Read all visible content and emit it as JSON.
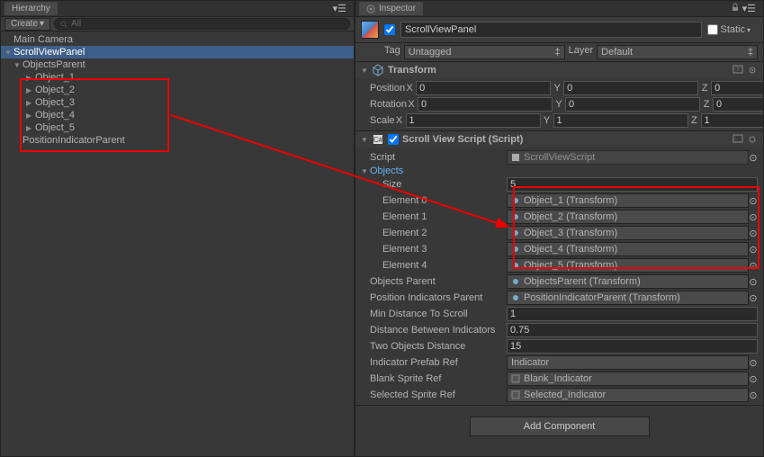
{
  "hierarchy": {
    "tab_label": "Hierarchy",
    "create_label": "Create",
    "search_placeholder": "All",
    "items": [
      {
        "label": "Main Camera",
        "indent": 0,
        "expand": ""
      },
      {
        "label": "ScrollViewPanel",
        "indent": 0,
        "expand": "down",
        "selected": true
      },
      {
        "label": "ObjectsParent",
        "indent": 1,
        "expand": "down"
      },
      {
        "label": "Object_1",
        "indent": 2,
        "expand": "right"
      },
      {
        "label": "Object_2",
        "indent": 2,
        "expand": "right"
      },
      {
        "label": "Object_3",
        "indent": 2,
        "expand": "right"
      },
      {
        "label": "Object_4",
        "indent": 2,
        "expand": "right"
      },
      {
        "label": "Object_5",
        "indent": 2,
        "expand": "right"
      },
      {
        "label": "PositionIndicatorParent",
        "indent": 1,
        "expand": ""
      }
    ]
  },
  "inspector": {
    "tab_label": "Inspector",
    "name": "ScrollViewPanel",
    "static_label": "Static",
    "tag_label": "Tag",
    "tag_value": "Untagged",
    "layer_label": "Layer",
    "layer_value": "Default",
    "transform": {
      "title": "Transform",
      "position_label": "Position",
      "rotation_label": "Rotation",
      "scale_label": "Scale",
      "position": {
        "x": "0",
        "y": "0",
        "z": "0"
      },
      "rotation": {
        "x": "0",
        "y": "0",
        "z": "0"
      },
      "scale": {
        "x": "1",
        "y": "1",
        "z": "1"
      }
    },
    "script": {
      "title": "Scroll View Script (Script)",
      "script_label": "Script",
      "script_value": "ScrollViewScript",
      "objects_label": "Objects",
      "size_label": "Size",
      "size_value": "5",
      "elements": [
        {
          "label": "Element 0",
          "value": "Object_1 (Transform)"
        },
        {
          "label": "Element 1",
          "value": "Object_2 (Transform)"
        },
        {
          "label": "Element 2",
          "value": "Object_3 (Transform)"
        },
        {
          "label": "Element 3",
          "value": "Object_4 (Transform)"
        },
        {
          "label": "Element 4",
          "value": "Object_5 (Transform)"
        }
      ],
      "objects_parent_label": "Objects Parent",
      "objects_parent_value": "ObjectsParent (Transform)",
      "pos_ind_parent_label": "Position Indicators Parent",
      "pos_ind_parent_value": "PositionIndicatorParent (Transform)",
      "min_dist_label": "Min Distance To Scroll",
      "min_dist_value": "1",
      "dist_between_label": "Distance Between Indicators",
      "dist_between_value": "0.75",
      "two_obj_label": "Two Objects Distance",
      "two_obj_value": "15",
      "indicator_prefab_label": "Indicator Prefab Ref",
      "indicator_prefab_value": "Indicator",
      "blank_sprite_label": "Blank Sprite Ref",
      "blank_sprite_value": "Blank_Indicator",
      "selected_sprite_label": "Selected Sprite Ref",
      "selected_sprite_value": "Selected_Indicator"
    },
    "add_component_label": "Add Component"
  }
}
